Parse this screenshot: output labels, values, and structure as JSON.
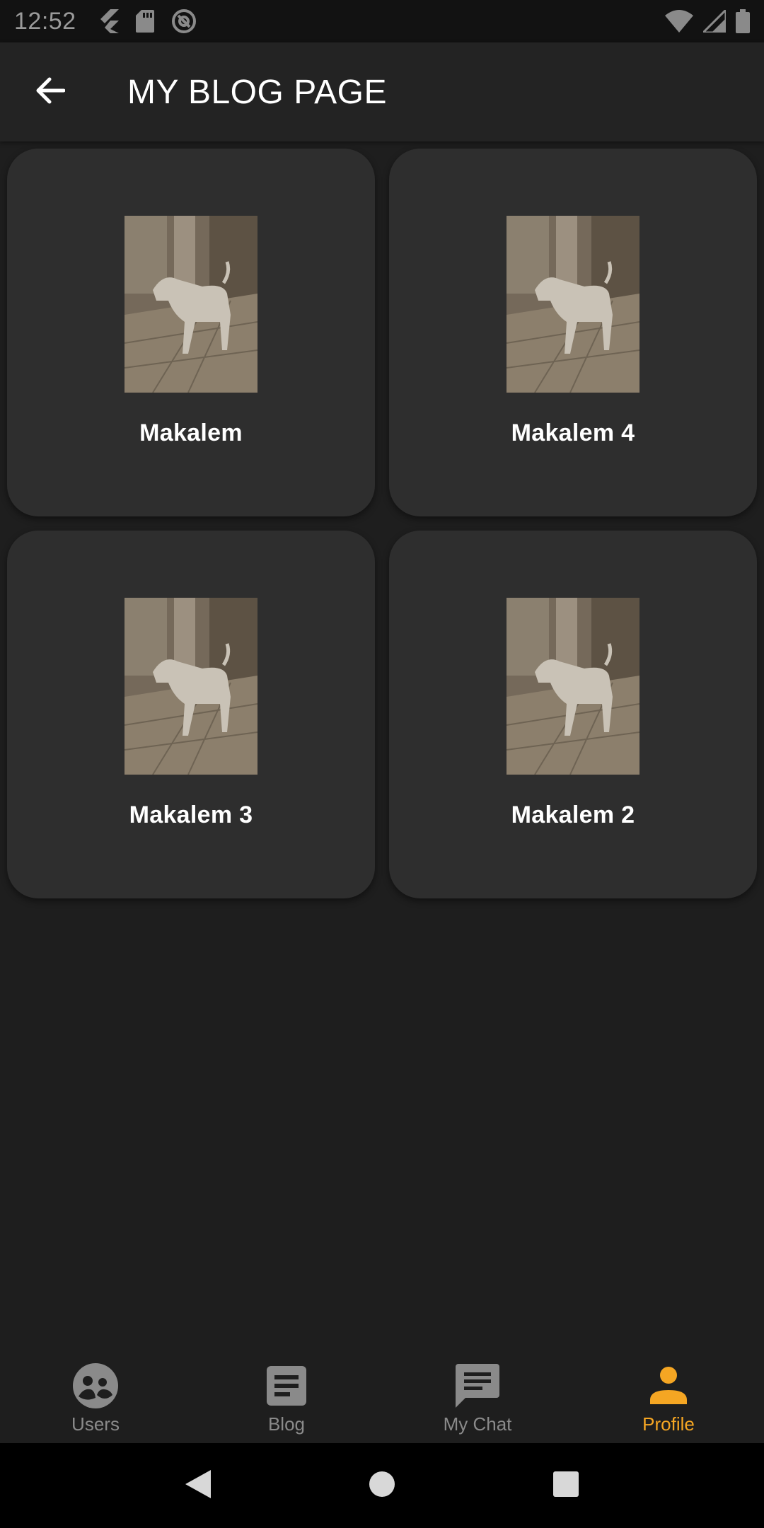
{
  "status_bar": {
    "time": "12:52",
    "left_icons": [
      "flutter-icon",
      "sd-card-icon",
      "at-sign-icon"
    ],
    "right_icons": [
      "wifi-icon",
      "signal-icon",
      "battery-icon"
    ]
  },
  "app_bar": {
    "back_icon": "arrow-back-icon",
    "title": "MY BLOG PAGE"
  },
  "cards": [
    {
      "title": "Makalem"
    },
    {
      "title": "Makalem 4"
    },
    {
      "title": "Makalem 3"
    },
    {
      "title": "Makalem 2"
    }
  ],
  "bottom_nav": {
    "items": [
      {
        "label": "Users",
        "icon": "users-icon",
        "active": false
      },
      {
        "label": "Blog",
        "icon": "article-icon",
        "active": false
      },
      {
        "label": "My Chat",
        "icon": "chat-icon",
        "active": false
      },
      {
        "label": "Profile",
        "icon": "person-icon",
        "active": true
      }
    ]
  },
  "colors": {
    "background": "#1e1e1e",
    "card": "#2e2e2e",
    "accent": "#f5a623",
    "inactive": "#8a8a8a"
  }
}
